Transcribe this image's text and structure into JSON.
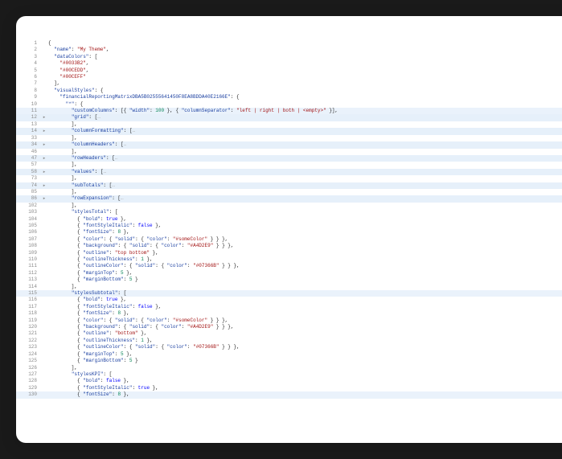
{
  "lines": [
    {
      "n": 1,
      "cls": "",
      "fold": "",
      "tokens": [
        [
          "brace",
          "{"
        ]
      ]
    },
    {
      "n": 2,
      "cls": "",
      "fold": "",
      "tokens": [
        [
          "",
          "  "
        ],
        [
          "key",
          "\"name\""
        ],
        [
          "",
          ": "
        ],
        [
          "str",
          "\"My Theme\""
        ],
        [
          "",
          ","
        ]
      ]
    },
    {
      "n": 3,
      "cls": "",
      "fold": "",
      "tokens": [
        [
          "",
          "  "
        ],
        [
          "key",
          "\"dataColors\""
        ],
        [
          "",
          ": ["
        ]
      ]
    },
    {
      "n": 4,
      "cls": "",
      "fold": "",
      "tokens": [
        [
          "",
          "    "
        ],
        [
          "str",
          "\"#0033B2\""
        ],
        [
          "",
          ","
        ]
      ]
    },
    {
      "n": 5,
      "cls": "",
      "fold": "",
      "tokens": [
        [
          "",
          "    "
        ],
        [
          "str",
          "\"#00CEDD\""
        ],
        [
          "",
          ","
        ]
      ]
    },
    {
      "n": 6,
      "cls": "",
      "fold": "",
      "tokens": [
        [
          "",
          "    "
        ],
        [
          "str",
          "\"#00CEFF\""
        ]
      ]
    },
    {
      "n": 7,
      "cls": "",
      "fold": "",
      "tokens": [
        [
          "",
          "  ],"
        ]
      ]
    },
    {
      "n": 8,
      "cls": "",
      "fold": "",
      "tokens": [
        [
          "",
          "  "
        ],
        [
          "key",
          "\"visualStyles\""
        ],
        [
          "",
          ": {"
        ]
      ]
    },
    {
      "n": 9,
      "cls": "",
      "fold": "",
      "tokens": [
        [
          "",
          "    "
        ],
        [
          "key",
          "\"financialReportingMatrixDBA5B02555641450F8EA8BDDA40E2166E\""
        ],
        [
          "",
          ": {"
        ]
      ]
    },
    {
      "n": 10,
      "cls": "",
      "fold": "",
      "tokens": [
        [
          "",
          "      "
        ],
        [
          "key",
          "\"*\""
        ],
        [
          "",
          ": {"
        ]
      ]
    },
    {
      "n": 11,
      "cls": "hl",
      "fold": "",
      "tokens": [
        [
          "",
          "        "
        ],
        [
          "key",
          "\"customColumns\""
        ],
        [
          "",
          ": [{ "
        ],
        [
          "key",
          "\"width\""
        ],
        [
          "",
          ": "
        ],
        [
          "num",
          "100"
        ],
        [
          "",
          " }, { "
        ],
        [
          "key",
          "\"columnSeparator\""
        ],
        [
          "",
          ": "
        ],
        [
          "str",
          "\"left | right | both | <empty>\""
        ],
        [
          "",
          " }],"
        ]
      ]
    },
    {
      "n": 12,
      "cls": "fold",
      "fold": ">",
      "tokens": [
        [
          "",
          "        "
        ],
        [
          "key",
          "\"grid\""
        ],
        [
          "",
          ": ["
        ],
        [
          "comment",
          "…"
        ]
      ]
    },
    {
      "n": 13,
      "cls": "",
      "fold": "",
      "tokens": [
        [
          "",
          "        ],"
        ]
      ]
    },
    {
      "n": 14,
      "cls": "fold",
      "fold": ">",
      "tokens": [
        [
          "",
          "        "
        ],
        [
          "key",
          "\"columnFormatting\""
        ],
        [
          "",
          ": ["
        ],
        [
          "comment",
          "…"
        ]
      ]
    },
    {
      "n": 33,
      "cls": "",
      "fold": "",
      "tokens": [
        [
          "",
          "        ],"
        ]
      ]
    },
    {
      "n": 34,
      "cls": "fold",
      "fold": ">",
      "tokens": [
        [
          "",
          "        "
        ],
        [
          "key",
          "\"columnHeaders\""
        ],
        [
          "",
          ": ["
        ],
        [
          "comment",
          "…"
        ]
      ]
    },
    {
      "n": 46,
      "cls": "",
      "fold": "",
      "tokens": [
        [
          "",
          "        ],"
        ]
      ]
    },
    {
      "n": 47,
      "cls": "fold",
      "fold": ">",
      "tokens": [
        [
          "",
          "        "
        ],
        [
          "key",
          "\"rowHeaders\""
        ],
        [
          "",
          ": ["
        ],
        [
          "comment",
          "…"
        ]
      ]
    },
    {
      "n": 57,
      "cls": "",
      "fold": "",
      "tokens": [
        [
          "",
          "        ],"
        ]
      ]
    },
    {
      "n": 58,
      "cls": "fold",
      "fold": ">",
      "tokens": [
        [
          "",
          "        "
        ],
        [
          "key",
          "\"values\""
        ],
        [
          "",
          ": ["
        ],
        [
          "comment",
          "…"
        ]
      ]
    },
    {
      "n": 73,
      "cls": "",
      "fold": "",
      "tokens": [
        [
          "",
          "        ],"
        ]
      ]
    },
    {
      "n": 74,
      "cls": "fold",
      "fold": ">",
      "tokens": [
        [
          "",
          "        "
        ],
        [
          "key",
          "\"subTotals\""
        ],
        [
          "",
          ": ["
        ],
        [
          "comment",
          "…"
        ]
      ]
    },
    {
      "n": 85,
      "cls": "",
      "fold": "",
      "tokens": [
        [
          "",
          "        ],"
        ]
      ]
    },
    {
      "n": 86,
      "cls": "fold",
      "fold": ">",
      "tokens": [
        [
          "",
          "        "
        ],
        [
          "key",
          "\"rowExpansion\""
        ],
        [
          "",
          ": ["
        ],
        [
          "comment",
          "…"
        ]
      ]
    },
    {
      "n": 102,
      "cls": "",
      "fold": "",
      "tokens": [
        [
          "",
          "        ],"
        ]
      ]
    },
    {
      "n": 103,
      "cls": "",
      "fold": "",
      "tokens": [
        [
          "",
          "        "
        ],
        [
          "key",
          "\"stylesTotal\""
        ],
        [
          "",
          ": ["
        ]
      ]
    },
    {
      "n": 104,
      "cls": "",
      "fold": "",
      "tokens": [
        [
          "",
          "          { "
        ],
        [
          "key",
          "\"bold\""
        ],
        [
          "",
          ": "
        ],
        [
          "bool",
          "true"
        ],
        [
          "",
          " },"
        ]
      ]
    },
    {
      "n": 105,
      "cls": "",
      "fold": "",
      "tokens": [
        [
          "",
          "          { "
        ],
        [
          "key",
          "\"fontStyleItalic\""
        ],
        [
          "",
          ": "
        ],
        [
          "bool",
          "false"
        ],
        [
          "",
          " },"
        ]
      ]
    },
    {
      "n": 106,
      "cls": "",
      "fold": "",
      "tokens": [
        [
          "",
          "          { "
        ],
        [
          "key",
          "\"fontSize\""
        ],
        [
          "",
          ": "
        ],
        [
          "num",
          "8"
        ],
        [
          "",
          " },"
        ]
      ]
    },
    {
      "n": 107,
      "cls": "",
      "fold": "",
      "tokens": [
        [
          "",
          "          { "
        ],
        [
          "key",
          "\"color\""
        ],
        [
          "",
          ": { "
        ],
        [
          "key",
          "\"solid\""
        ],
        [
          "",
          ": { "
        ],
        [
          "key",
          "\"color\""
        ],
        [
          "",
          ": "
        ],
        [
          "str",
          "\"#someColor\""
        ],
        [
          "",
          " } } },"
        ]
      ]
    },
    {
      "n": 108,
      "cls": "",
      "fold": "",
      "tokens": [
        [
          "",
          "          { "
        ],
        [
          "key",
          "\"background\""
        ],
        [
          "",
          ": { "
        ],
        [
          "key",
          "\"solid\""
        ],
        [
          "",
          ": { "
        ],
        [
          "key",
          "\"color\""
        ],
        [
          "",
          ": "
        ],
        [
          "str",
          "\"#A4D2E9\""
        ],
        [
          "",
          " } } },"
        ]
      ]
    },
    {
      "n": 109,
      "cls": "",
      "fold": "",
      "tokens": [
        [
          "",
          "          { "
        ],
        [
          "key",
          "\"outline\""
        ],
        [
          "",
          ": "
        ],
        [
          "str",
          "\"top bottom\""
        ],
        [
          "",
          " },"
        ]
      ]
    },
    {
      "n": 110,
      "cls": "",
      "fold": "",
      "tokens": [
        [
          "",
          "          { "
        ],
        [
          "key",
          "\"outlineThickness\""
        ],
        [
          "",
          ": "
        ],
        [
          "num",
          "1"
        ],
        [
          "",
          " },"
        ]
      ]
    },
    {
      "n": 111,
      "cls": "",
      "fold": "",
      "tokens": [
        [
          "",
          "          { "
        ],
        [
          "key",
          "\"outlineColor\""
        ],
        [
          "",
          ": { "
        ],
        [
          "key",
          "\"solid\""
        ],
        [
          "",
          ": { "
        ],
        [
          "key",
          "\"color\""
        ],
        [
          "",
          ": "
        ],
        [
          "str",
          "\"#07366B\""
        ],
        [
          "",
          " } } },"
        ]
      ]
    },
    {
      "n": 112,
      "cls": "",
      "fold": "",
      "tokens": [
        [
          "",
          "          { "
        ],
        [
          "key",
          "\"marginTop\""
        ],
        [
          "",
          ": "
        ],
        [
          "num",
          "5"
        ],
        [
          "",
          " },"
        ]
      ]
    },
    {
      "n": 113,
      "cls": "",
      "fold": "",
      "tokens": [
        [
          "",
          "          { "
        ],
        [
          "key",
          "\"marginBottom\""
        ],
        [
          "",
          ": "
        ],
        [
          "num",
          "5"
        ],
        [
          "",
          " }"
        ]
      ]
    },
    {
      "n": 114,
      "cls": "",
      "fold": "",
      "tokens": [
        [
          "",
          "        ],"
        ]
      ]
    },
    {
      "n": 115,
      "cls": "hl",
      "fold": "",
      "tokens": [
        [
          "",
          "        "
        ],
        [
          "key",
          "\"stylesSubtotal\""
        ],
        [
          "",
          ": ["
        ]
      ]
    },
    {
      "n": 116,
      "cls": "",
      "fold": "",
      "tokens": [
        [
          "",
          "          { "
        ],
        [
          "key",
          "\"bold\""
        ],
        [
          "",
          ": "
        ],
        [
          "bool",
          "true"
        ],
        [
          "",
          " },"
        ]
      ]
    },
    {
      "n": 117,
      "cls": "",
      "fold": "",
      "tokens": [
        [
          "",
          "          { "
        ],
        [
          "key",
          "\"fontStyleItalic\""
        ],
        [
          "",
          ": "
        ],
        [
          "bool",
          "false"
        ],
        [
          "",
          " },"
        ]
      ]
    },
    {
      "n": 118,
      "cls": "",
      "fold": "",
      "tokens": [
        [
          "",
          "          { "
        ],
        [
          "key",
          "\"fontSize\""
        ],
        [
          "",
          ": "
        ],
        [
          "num",
          "8"
        ],
        [
          "",
          " },"
        ]
      ]
    },
    {
      "n": 119,
      "cls": "",
      "fold": "",
      "tokens": [
        [
          "",
          "          { "
        ],
        [
          "key",
          "\"color\""
        ],
        [
          "",
          ": { "
        ],
        [
          "key",
          "\"solid\""
        ],
        [
          "",
          ": { "
        ],
        [
          "key",
          "\"color\""
        ],
        [
          "",
          ": "
        ],
        [
          "str",
          "\"#someColor\""
        ],
        [
          "",
          " } } },"
        ]
      ]
    },
    {
      "n": 120,
      "cls": "",
      "fold": "",
      "tokens": [
        [
          "",
          "          { "
        ],
        [
          "key",
          "\"background\""
        ],
        [
          "",
          ": { "
        ],
        [
          "key",
          "\"solid\""
        ],
        [
          "",
          ": { "
        ],
        [
          "key",
          "\"color\""
        ],
        [
          "",
          ": "
        ],
        [
          "str",
          "\"#A4D2E9\""
        ],
        [
          "",
          " } } },"
        ]
      ]
    },
    {
      "n": 121,
      "cls": "",
      "fold": "",
      "tokens": [
        [
          "",
          "          { "
        ],
        [
          "key",
          "\"outline\""
        ],
        [
          "",
          ": "
        ],
        [
          "str",
          "\"bottom\""
        ],
        [
          "",
          " },"
        ]
      ]
    },
    {
      "n": 122,
      "cls": "",
      "fold": "",
      "tokens": [
        [
          "",
          "          { "
        ],
        [
          "key",
          "\"outlineThickness\""
        ],
        [
          "",
          ": "
        ],
        [
          "num",
          "1"
        ],
        [
          "",
          " },"
        ]
      ]
    },
    {
      "n": 123,
      "cls": "",
      "fold": "",
      "tokens": [
        [
          "",
          "          { "
        ],
        [
          "key",
          "\"outlineColor\""
        ],
        [
          "",
          ": { "
        ],
        [
          "key",
          "\"solid\""
        ],
        [
          "",
          ": { "
        ],
        [
          "key",
          "\"color\""
        ],
        [
          "",
          ": "
        ],
        [
          "str",
          "\"#07366B\""
        ],
        [
          "",
          " } } },"
        ]
      ]
    },
    {
      "n": 124,
      "cls": "",
      "fold": "",
      "tokens": [
        [
          "",
          "          { "
        ],
        [
          "key",
          "\"marginTop\""
        ],
        [
          "",
          ": "
        ],
        [
          "num",
          "5"
        ],
        [
          "",
          " },"
        ]
      ]
    },
    {
      "n": 125,
      "cls": "",
      "fold": "",
      "tokens": [
        [
          "",
          "          { "
        ],
        [
          "key",
          "\"marginBottom\""
        ],
        [
          "",
          ": "
        ],
        [
          "num",
          "5"
        ],
        [
          "",
          " }"
        ]
      ]
    },
    {
      "n": 126,
      "cls": "",
      "fold": "",
      "tokens": [
        [
          "",
          "        ],"
        ]
      ]
    },
    {
      "n": 127,
      "cls": "",
      "fold": "",
      "tokens": [
        [
          "",
          "        "
        ],
        [
          "key",
          "\"stylesKPI\""
        ],
        [
          "",
          ": ["
        ]
      ]
    },
    {
      "n": 128,
      "cls": "",
      "fold": "",
      "tokens": [
        [
          "",
          "          { "
        ],
        [
          "key",
          "\"bold\""
        ],
        [
          "",
          ": "
        ],
        [
          "bool",
          "false"
        ],
        [
          "",
          " },"
        ]
      ]
    },
    {
      "n": 129,
      "cls": "",
      "fold": "",
      "tokens": [
        [
          "",
          "          { "
        ],
        [
          "key",
          "\"fontStyleItalic\""
        ],
        [
          "",
          ": "
        ],
        [
          "bool",
          "true"
        ],
        [
          "",
          " },"
        ]
      ]
    },
    {
      "n": 130,
      "cls": "hl",
      "fold": "",
      "tokens": [
        [
          "",
          "          { "
        ],
        [
          "key",
          "\"fontSize\""
        ],
        [
          "",
          ": "
        ],
        [
          "num",
          "8"
        ],
        [
          "",
          " },"
        ]
      ]
    }
  ]
}
